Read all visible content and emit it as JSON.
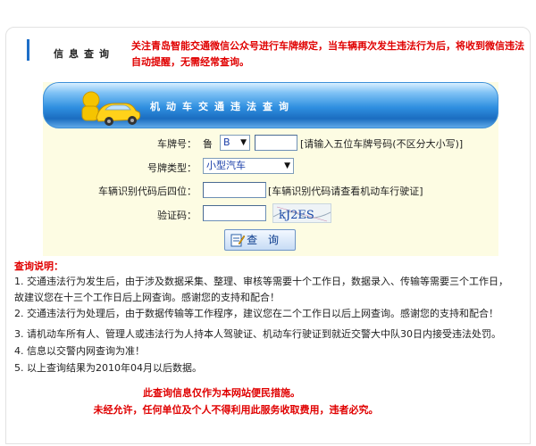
{
  "header": {
    "title": "信息查询",
    "notice": "关注青岛智能交通微信公众号进行车牌绑定，当车辆再次发生违法行为后，将收到微信违法自动提醒，无需经常查询。"
  },
  "banner": {
    "title": "机动车交通违法查询"
  },
  "form": {
    "plate_label": "车牌号：",
    "plate_prefix": "鲁",
    "plate_letter": "B",
    "plate_hint": "[请输入五位车牌号码(不区分大小写)]",
    "type_label": "号牌类型：",
    "type_value": "小型汽车",
    "vin_label": "车辆识别代码后四位：",
    "vin_hint": "[车辆识别代码请查看机动车行驶证]",
    "captcha_label": "验证码：",
    "captcha_text": "kJ2ES",
    "submit_label": "查 询"
  },
  "help": {
    "title": "查询说明：",
    "items": [
      "1. 交通违法行为发生后，由于涉及数据采集、整理、审核等需要十个工作日，数据录入、传输等需要三个工作日，",
      "故建议您在十三个工作日后上网查询。感谢您的支持和配合！",
      "2. 交通违法行为处理后，由于数据传输等工作程序，建议您在二个工作日以后上网查询。感谢您的支持和配合！",
      "3. 请机动车所有人、管理人或违法行为人持本人驾驶证、机动车行驶证到就近交警大中队30日内接受违法处罚。",
      "4. 信息以交警内网查询为准！",
      "5. 以上查询结果为2010年04月以后数据。"
    ]
  },
  "footer": {
    "line1": "此查询信息仅作为本网站便民措施。",
    "line2": "未经允许，任何单位及个人不得利用此服务收取费用，违者必究。"
  },
  "colors": {
    "accent": "#1e6fc8",
    "warning": "#e00000",
    "form_bg": "#fdfce3"
  }
}
